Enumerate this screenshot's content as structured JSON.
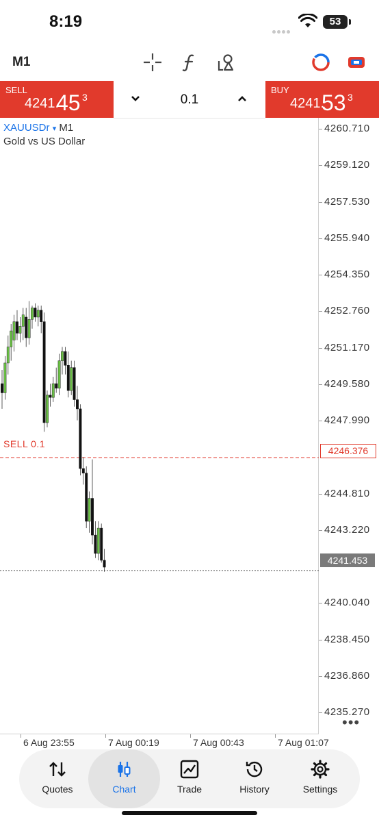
{
  "status_bar": {
    "time": "8:19",
    "battery": "53"
  },
  "toolbar": {
    "timeframe": "M1"
  },
  "trade_panel": {
    "sell": {
      "label": "SELL",
      "price_small": "4241.",
      "price_big": "45",
      "price_sup": "3"
    },
    "buy": {
      "label": "BUY",
      "price_small": "4241.",
      "price_big": "53",
      "price_sup": "3"
    },
    "volume": "0.1"
  },
  "chart": {
    "symbol": "XAUUSDr",
    "symbol_arrow": "▾",
    "timeframe": "M1",
    "description": "Gold vs US Dollar",
    "order_label": "SELL 0.1",
    "order_price": "4246.376",
    "bid_price": "4241.453",
    "more": "•••"
  },
  "chart_data": {
    "type": "candlestick",
    "symbol": "XAUUSDr",
    "timeframe": "M1",
    "ylim": [
      4234.0,
      4261.6
    ],
    "y_ticks": [
      "4260.710",
      "4259.120",
      "4257.530",
      "4255.940",
      "4254.350",
      "4252.760",
      "4251.170",
      "4249.580",
      "4247.990",
      "4244.810",
      "4243.220",
      "4240.040",
      "4238.450",
      "4236.860",
      "4235.270"
    ],
    "x_ticks": [
      "6 Aug 23:55",
      "7 Aug 00:19",
      "7 Aug 00:43",
      "7 Aug 01:07"
    ],
    "candles": [
      {
        "o": 4249.6,
        "h": 4250.2,
        "l": 4248.5,
        "c": 4249.2
      },
      {
        "o": 4249.2,
        "h": 4250.8,
        "l": 4248.9,
        "c": 4250.5
      },
      {
        "o": 4250.5,
        "h": 4251.7,
        "l": 4250.0,
        "c": 4251.2
      },
      {
        "o": 4251.2,
        "h": 4252.2,
        "l": 4250.6,
        "c": 4251.9
      },
      {
        "o": 4251.5,
        "h": 4252.6,
        "l": 4251.0,
        "c": 4252.3
      },
      {
        "o": 4252.3,
        "h": 4252.8,
        "l": 4251.5,
        "c": 4251.8
      },
      {
        "o": 4251.8,
        "h": 4252.5,
        "l": 4251.4,
        "c": 4252.1
      },
      {
        "o": 4252.1,
        "h": 4252.9,
        "l": 4251.5,
        "c": 4252.6
      },
      {
        "o": 4252.5,
        "h": 4252.9,
        "l": 4251.2,
        "c": 4251.6
      },
      {
        "o": 4251.6,
        "h": 4253.2,
        "l": 4251.3,
        "c": 4252.4
      },
      {
        "o": 4252.4,
        "h": 4253.0,
        "l": 4252.0,
        "c": 4252.9
      },
      {
        "o": 4252.9,
        "h": 4253.1,
        "l": 4252.3,
        "c": 4252.5
      },
      {
        "o": 4252.5,
        "h": 4253.0,
        "l": 4252.1,
        "c": 4252.8
      },
      {
        "o": 4252.8,
        "h": 4253.0,
        "l": 4251.8,
        "c": 4252.3
      },
      {
        "o": 4252.3,
        "h": 4252.7,
        "l": 4247.5,
        "c": 4247.9
      },
      {
        "o": 4247.9,
        "h": 4249.3,
        "l": 4247.7,
        "c": 4249.1
      },
      {
        "o": 4249.1,
        "h": 4249.6,
        "l": 4248.6,
        "c": 4249.0
      },
      {
        "o": 4249.0,
        "h": 4249.9,
        "l": 4248.8,
        "c": 4249.6
      },
      {
        "o": 4249.6,
        "h": 4250.3,
        "l": 4249.2,
        "c": 4249.4
      },
      {
        "o": 4249.4,
        "h": 4250.9,
        "l": 4249.1,
        "c": 4250.6
      },
      {
        "o": 4250.6,
        "h": 4251.2,
        "l": 4250.0,
        "c": 4251.0
      },
      {
        "o": 4251.0,
        "h": 4251.2,
        "l": 4250.0,
        "c": 4250.4
      },
      {
        "o": 4250.4,
        "h": 4251.0,
        "l": 4249.0,
        "c": 4249.3
      },
      {
        "o": 4249.3,
        "h": 4250.6,
        "l": 4249.1,
        "c": 4250.3
      },
      {
        "o": 4250.3,
        "h": 4250.6,
        "l": 4248.6,
        "c": 4248.9
      },
      {
        "o": 4248.9,
        "h": 4249.5,
        "l": 4248.0,
        "c": 4248.5
      },
      {
        "o": 4248.5,
        "h": 4248.7,
        "l": 4245.6,
        "c": 4245.9
      },
      {
        "o": 4245.9,
        "h": 4246.4,
        "l": 4245.2,
        "c": 4245.7
      },
      {
        "o": 4245.7,
        "h": 4246.0,
        "l": 4243.3,
        "c": 4243.6
      },
      {
        "o": 4243.6,
        "h": 4244.9,
        "l": 4243.1,
        "c": 4244.6
      },
      {
        "o": 4244.6,
        "h": 4246.3,
        "l": 4242.6,
        "c": 4243.0
      },
      {
        "o": 4243.0,
        "h": 4243.6,
        "l": 4242.0,
        "c": 4242.2
      },
      {
        "o": 4242.2,
        "h": 4243.6,
        "l": 4241.9,
        "c": 4243.3
      },
      {
        "o": 4243.3,
        "h": 4243.5,
        "l": 4241.8,
        "c": 4241.9
      },
      {
        "o": 4241.9,
        "h": 4242.4,
        "l": 4241.4,
        "c": 4241.6
      }
    ],
    "bull_color": "#6abf45",
    "bear_color": "#111111",
    "order_line": {
      "label": "SELL 0.1",
      "price": 4246.376,
      "color": "#e13a2c"
    },
    "bid_line": {
      "price": 4241.453,
      "color": "#7a7a7a"
    }
  },
  "tabs": [
    {
      "label": "Quotes",
      "icon": "sort-arrows-icon"
    },
    {
      "label": "Chart",
      "icon": "candles-icon",
      "active": true
    },
    {
      "label": "Trade",
      "icon": "trend-chart-icon"
    },
    {
      "label": "History",
      "icon": "history-icon"
    },
    {
      "label": "Settings",
      "icon": "gear-icon"
    }
  ],
  "colors": {
    "accent": "#1a73e8",
    "sell_buy": "#e13a2c"
  }
}
